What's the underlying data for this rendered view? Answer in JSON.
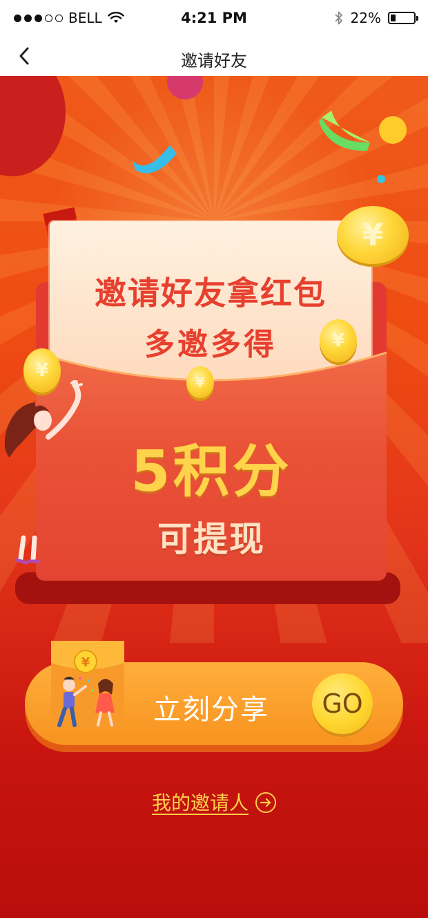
{
  "status_bar": {
    "carrier": "BELL",
    "time": "4:21 PM",
    "battery_percent": "22%",
    "battery_level": 0.22,
    "signal_strength": 3,
    "icons": [
      "wifi-icon",
      "bluetooth-icon",
      "battery-icon"
    ]
  },
  "nav": {
    "title": "邀请好友",
    "back_icon": "chevron-left-icon"
  },
  "promo": {
    "card_title": "邀请好友拿红包",
    "card_subtitle": "多邀多得",
    "points_value": "5积分",
    "points_note": "可提现",
    "coin_symbol": "¥",
    "envelope_symbol": "¥"
  },
  "share": {
    "label": "立刻分享",
    "go_label": "GO"
  },
  "inviter_link": {
    "label": "我的邀请人"
  },
  "colors": {
    "background_top": "#ef5a1a",
    "background_bottom": "#b80e0b",
    "title_red": "#e7402f",
    "points_gold": "#ffd34a",
    "button_orange": "#f8931f",
    "link_gold": "#ffcf4a"
  }
}
